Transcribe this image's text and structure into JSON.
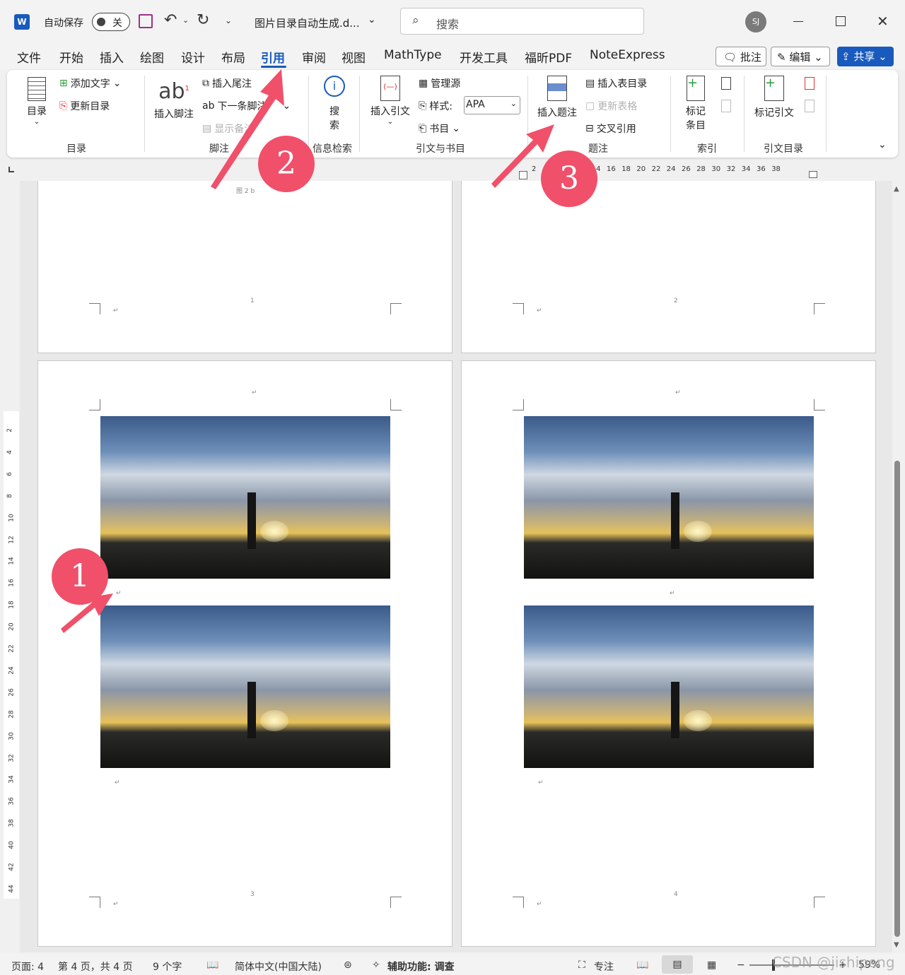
{
  "titlebar": {
    "autosave_label": "自动保存",
    "autosave_state": "关",
    "doc_title": "图片目录自动生成.d...",
    "search_placeholder": "搜索",
    "user_initials": "SJ"
  },
  "menu": {
    "tabs": [
      "文件",
      "开始",
      "插入",
      "绘图",
      "设计",
      "布局",
      "引用",
      "审阅",
      "视图",
      "MathType",
      "开发工具",
      "福昕PDF",
      "NoteExpress"
    ],
    "active_tab": "引用",
    "comment_btn": "批注",
    "edit_btn": "编辑",
    "share_btn": "共享"
  },
  "ribbon": {
    "toc": {
      "big": "目录",
      "add_text": "添加文字",
      "update_toc": "更新目录",
      "group": "目录"
    },
    "footnotes": {
      "big": "插入脚注",
      "insert_endnote": "插入尾注",
      "next_footnote": "下一条脚注",
      "show_notes": "显示备注",
      "group": "脚注"
    },
    "research": {
      "big1": "搜",
      "big2": "索",
      "group": "信息检索"
    },
    "citations": {
      "big": "插入引文",
      "manage_sources": "管理源",
      "style_label": "样式:",
      "style_value": "APA",
      "bibliography": "书目",
      "group": "引文与书目"
    },
    "captions": {
      "big": "插入题注",
      "insert_tof": "插入表目录",
      "update_table": "更新表格",
      "cross_ref": "交叉引用",
      "group": "题注"
    },
    "index": {
      "big1": "标记",
      "big2": "条目",
      "group": "索引"
    },
    "toa": {
      "big": "标记引文",
      "group": "引文目录"
    }
  },
  "ruler": {
    "ticks": [
      "2",
      "",
      "10",
      "12",
      "14",
      "16",
      "18",
      "20",
      "22",
      "24",
      "26",
      "28",
      "30",
      "32",
      "34",
      "36",
      "38"
    ]
  },
  "vruler": {
    "ticks": [
      "2",
      "4",
      "6",
      "8",
      "10",
      "12",
      "14",
      "16",
      "18",
      "20",
      "22",
      "24",
      "26",
      "28",
      "30",
      "32",
      "34",
      "36",
      "38",
      "40",
      "42",
      "44"
    ]
  },
  "pages": {
    "p1_caption": "图 2 b",
    "p1_num": "1",
    "p2_num": "2",
    "p3_num": "3",
    "p4_num": "4",
    "para_mark": "↵"
  },
  "annotations": {
    "n1": "1",
    "n2": "2",
    "n3": "3"
  },
  "status": {
    "page": "页面: 4",
    "page_of": "第 4 页，共 4 页",
    "words": "9 个字",
    "lang": "简体中文(中国大陆)",
    "accessibility": "辅助功能: 调查",
    "focus": "专注",
    "zoom": "59%",
    "watermark": "CSDN @jishipeng"
  },
  "colors": {
    "accent": "#185abd",
    "annotation": "#f0506a"
  }
}
